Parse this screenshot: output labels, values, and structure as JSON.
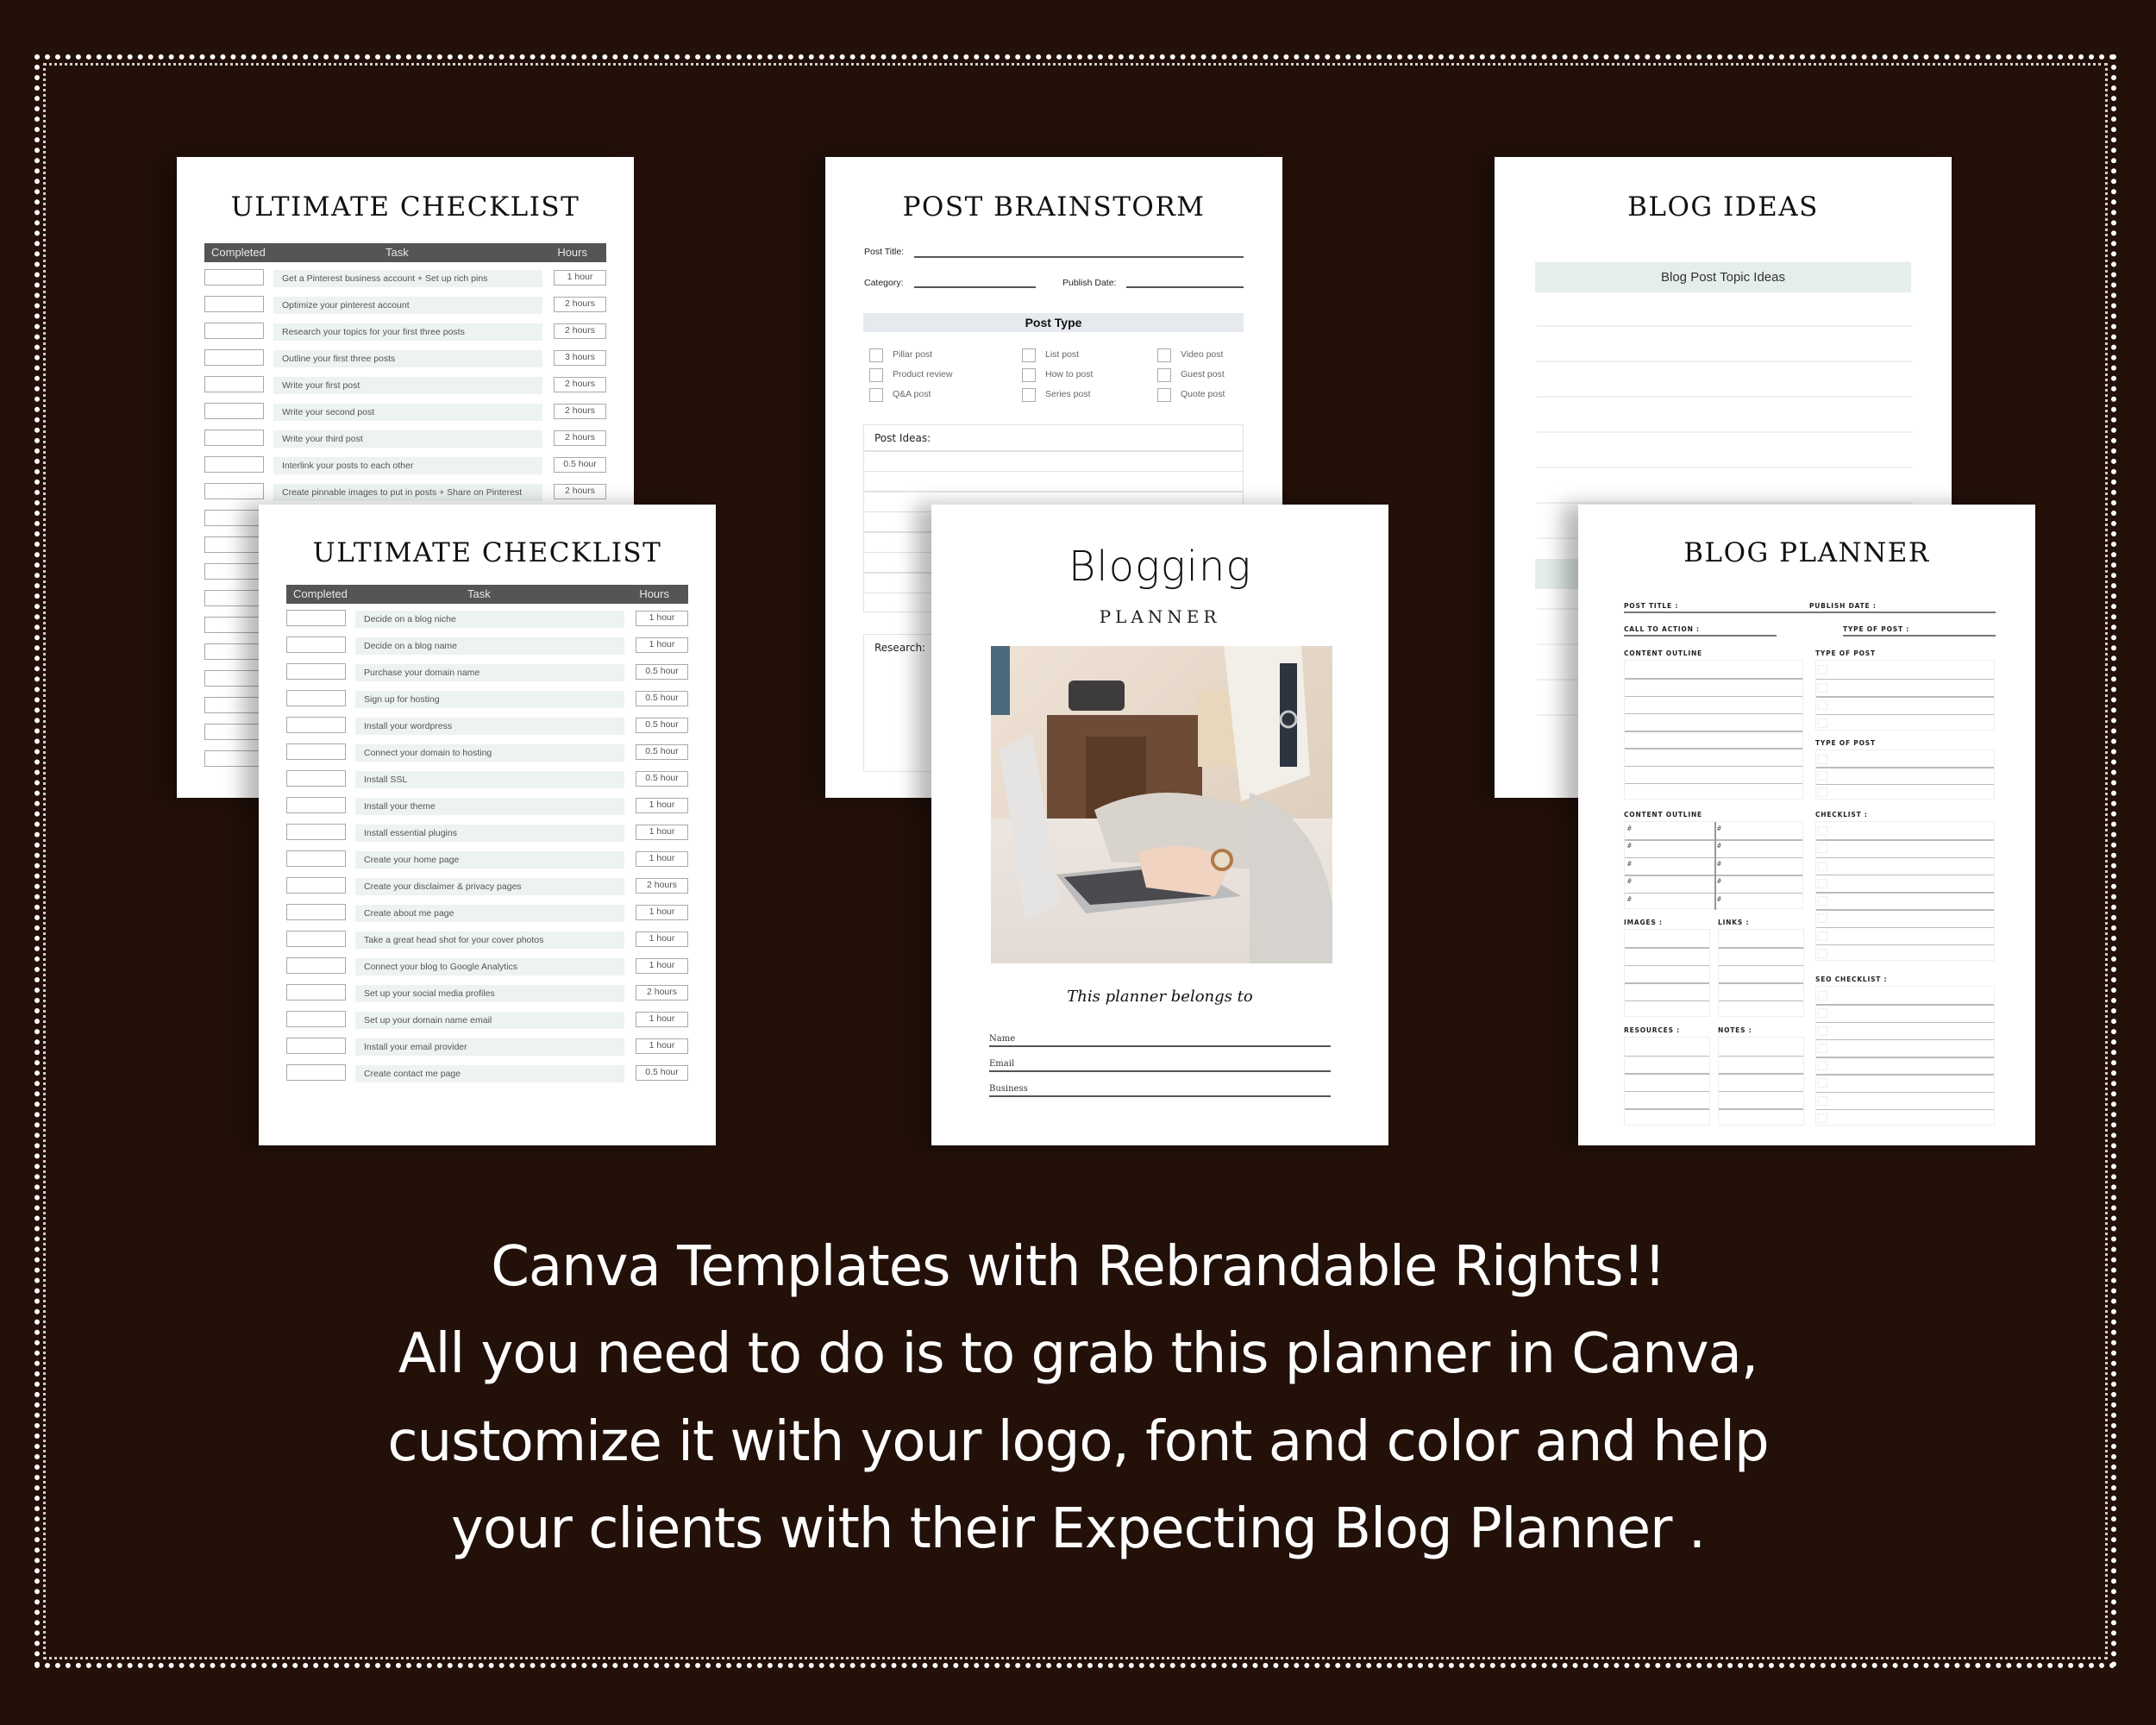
{
  "colors": {
    "background": "#221009",
    "border": "#ffffff",
    "table_header": "#555555",
    "task_fill": "#ecf3f2",
    "post_type_bar": "#e6e9ee",
    "topic_bar": "#e5eded"
  },
  "pages": {
    "checklist_back": {
      "title": "ULTIMATE CHECKLIST",
      "columns": [
        "Completed",
        "Task",
        "Hours"
      ],
      "rows": [
        {
          "task": "Get a Pinterest business account + Set up rich pins",
          "hours": "1 hour"
        },
        {
          "task": "Optimize your pinterest account",
          "hours": "2 hours"
        },
        {
          "task": "Research your topics for your first three posts",
          "hours": "2 hours"
        },
        {
          "task": "Outline your first three posts",
          "hours": "3 hours"
        },
        {
          "task": "Write your first post",
          "hours": "2 hours"
        },
        {
          "task": "Write your second post",
          "hours": "2 hours"
        },
        {
          "task": "Write your third post",
          "hours": "2 hours"
        },
        {
          "task": "Interlink your posts to each other",
          "hours": "0.5 hour"
        },
        {
          "task": "Create pinnable images to put in posts + Share on Pinterest",
          "hours": "2 hours"
        }
      ]
    },
    "checklist_front": {
      "title": "ULTIMATE CHECKLIST",
      "columns": [
        "Completed",
        "Task",
        "Hours"
      ],
      "rows": [
        {
          "task": "Decide on a blog niche",
          "hours": "1 hour"
        },
        {
          "task": "Decide on a blog name",
          "hours": "1 hour"
        },
        {
          "task": "Purchase your domain name",
          "hours": "0.5 hour"
        },
        {
          "task": "Sign up for hosting",
          "hours": "0.5 hour"
        },
        {
          "task": "Install your wordpress",
          "hours": "0.5 hour"
        },
        {
          "task": "Connect your domain to hosting",
          "hours": "0.5 hour"
        },
        {
          "task": "Install SSL",
          "hours": "0.5 hour"
        },
        {
          "task": "Install your theme",
          "hours": "1 hour"
        },
        {
          "task": "Install essential plugins",
          "hours": "1 hour"
        },
        {
          "task": "Create your home page",
          "hours": "1 hour"
        },
        {
          "task": "Create your disclaimer & privacy pages",
          "hours": "2 hours"
        },
        {
          "task": "Create about me page",
          "hours": "1 hour"
        },
        {
          "task": "Take a great head shot for your cover photos",
          "hours": "1 hour"
        },
        {
          "task": "Connect your blog to Google Analytics",
          "hours": "1 hour"
        },
        {
          "task": "Set up your social media profiles",
          "hours": "2 hours"
        },
        {
          "task": "Set up your domain name email",
          "hours": "1 hour"
        },
        {
          "task": "Install your email provider",
          "hours": "1 hour"
        },
        {
          "task": "Create contact me page",
          "hours": "0.5 hour"
        }
      ]
    },
    "post_brainstorm": {
      "title": "POST BRAINSTORM",
      "post_title_label": "Post Title:",
      "category_label": "Category:",
      "publish_date_label": "Publish Date:",
      "post_type_heading": "Post Type",
      "post_types": [
        [
          "Pillar post",
          "Product review",
          "Q&A post"
        ],
        [
          "List post",
          "How to post",
          "Series post"
        ],
        [
          "Video post",
          "Guest post",
          "Quote post"
        ]
      ],
      "post_ideas_label": "Post Ideas:",
      "research_label": "Research:"
    },
    "cover": {
      "title": "Blogging",
      "subtitle": "PLANNER",
      "photo_alt": "woman typing on laptop",
      "belongs_to": "This planner belongs to",
      "fields": [
        "Name",
        "Email",
        "Business"
      ]
    },
    "blog_ideas": {
      "title": "BLOG IDEAS",
      "topic_header": "Blog Post Topic Ideas"
    },
    "blog_planner": {
      "title": "BLOG PLANNER",
      "post_title": "POST TITLE :",
      "publish_date": "PUBLISH DATE :",
      "call_to_action": "CALL TO ACTION :",
      "type_of_post_inline": "TYPE OF POST :",
      "content_outline": "CONTENT OUTLINE",
      "type_of_post_1": "TYPE OF POST",
      "type_of_post_2": "TYPE OF POST",
      "content_outline_2": "CONTENT OUTLINE",
      "checklist": "CHECKLIST :",
      "images": "IMAGES :",
      "links": "LINKS :",
      "seo_checklist": "SEO CHECKLIST :",
      "resources": "RESOURCES :",
      "notes": "NOTES :",
      "hash": "#"
    }
  },
  "tagline": [
    "Canva Templates with Rebrandable Rights!!",
    "All you need to do is to grab this planner in Canva,",
    "customize it with your logo, font and color and help",
    "your clients with their Expecting Blog Planner ."
  ]
}
